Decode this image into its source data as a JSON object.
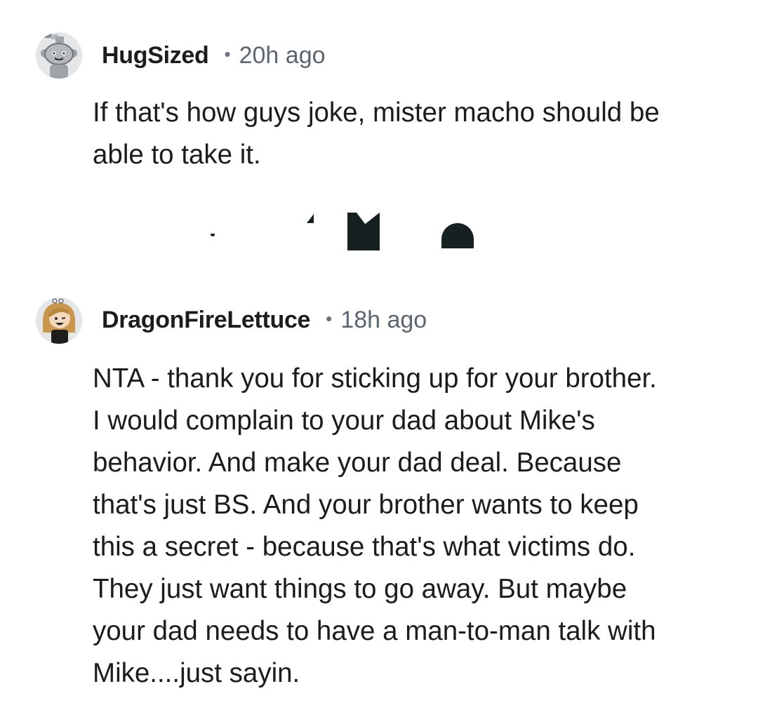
{
  "comments": [
    {
      "username": "HugSized",
      "separator": "•",
      "time": "20h ago",
      "avatar_icon": "snoo-robot-avatar",
      "body_lines": [
        "If that's how guys joke, mister macho should be",
        "able to take it."
      ]
    },
    {
      "username": "DragonFireLettuce",
      "separator": "•",
      "time": "18h ago",
      "avatar_icon": "snoo-girl-avatar",
      "body_lines": [
        "NTA - thank you for sticking up for your brother.",
        "I would complain to your dad about Mike's",
        "behavior. And make your dad deal. Because",
        "that's just BS. And your brother wants to keep",
        "this a secret - because that's what victims do.",
        "They just want things to go away. But maybe",
        "your dad needs to have a man-to-man talk with",
        "Mike....just sayin."
      ]
    }
  ],
  "colors": {
    "text": "#1c1c1c",
    "meta": "#5c6670",
    "avatar_bg": "#e4e6e8",
    "artifact": "#162020"
  }
}
